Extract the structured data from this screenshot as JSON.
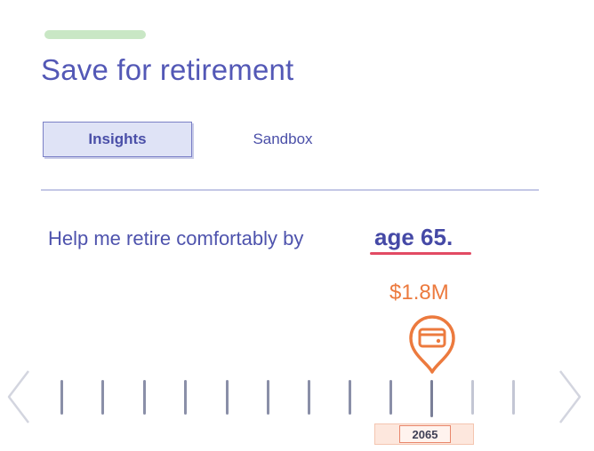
{
  "header": {
    "title": "Save for retirement"
  },
  "progress": {
    "color": "#c9e7c5"
  },
  "tabs": [
    {
      "label": "Insights",
      "active": true
    },
    {
      "label": "Sandbox",
      "active": false
    }
  ],
  "goal": {
    "prefix": "Help me retire comfortably by",
    "age_label": "age 65."
  },
  "projection": {
    "amount": "$1.8M",
    "marker_icon": "credit-card-icon"
  },
  "timeline": {
    "selected_year": "2065",
    "tick_count": 12,
    "selected_index": 9
  },
  "colors": {
    "primary": "#5358b6",
    "accent": "#ec7a3e",
    "underline": "#e24a63"
  }
}
